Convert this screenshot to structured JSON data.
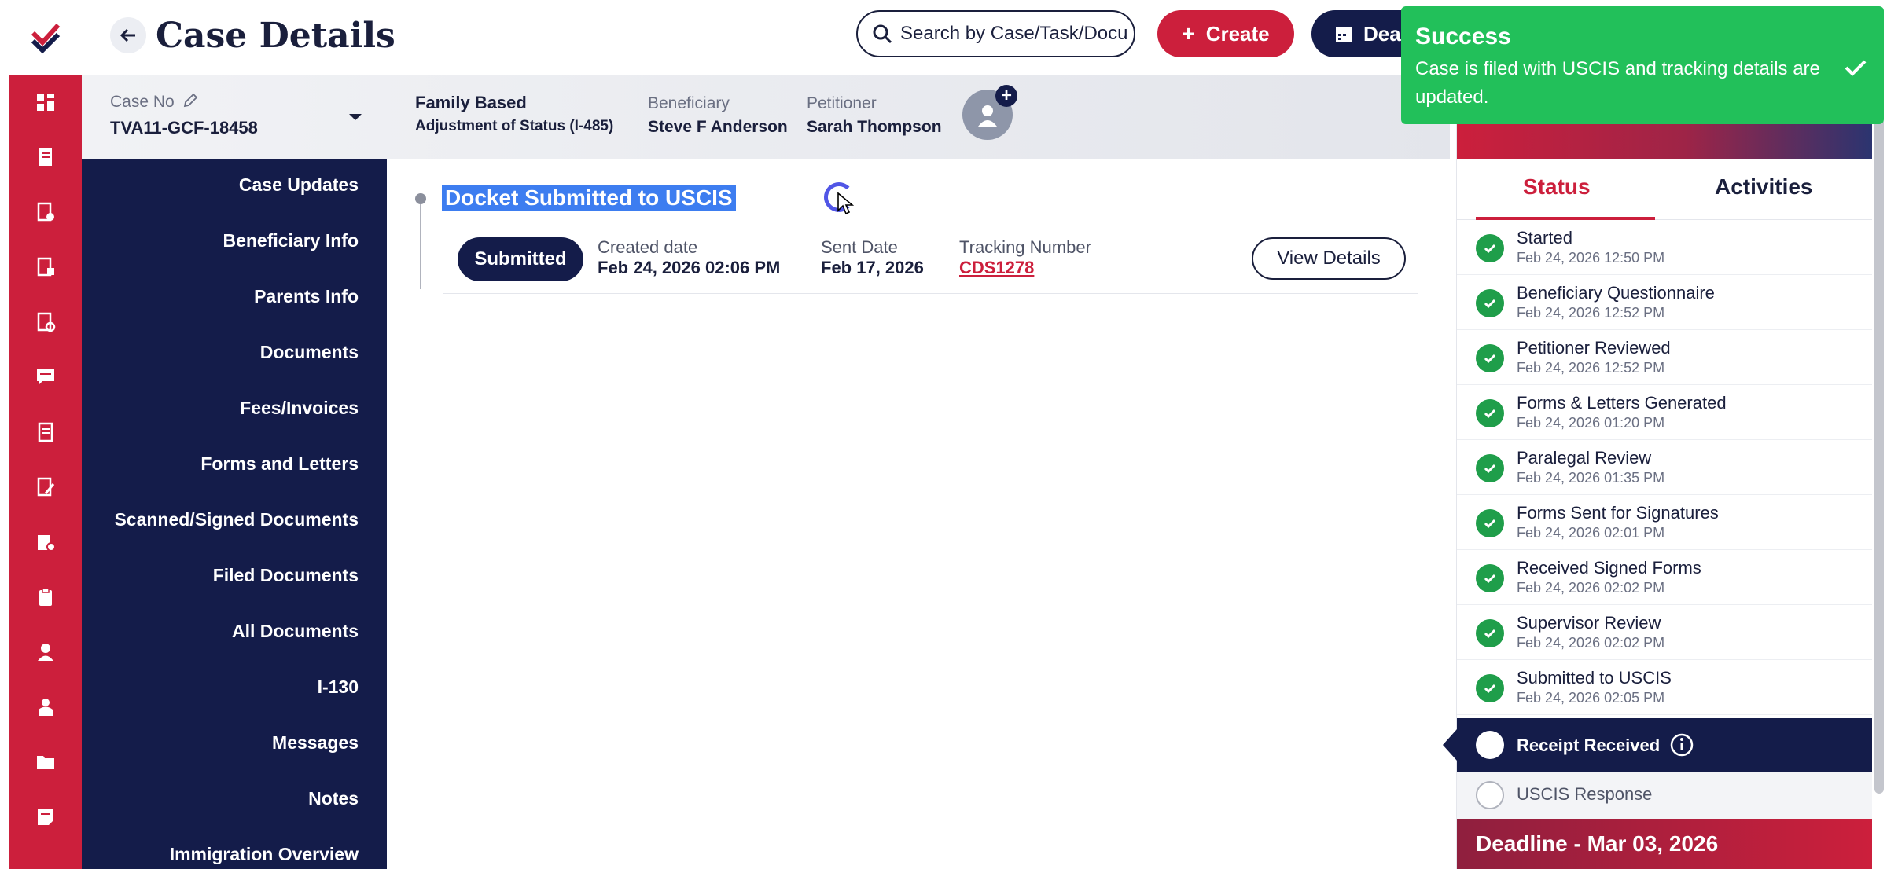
{
  "header": {
    "title": "Case Details",
    "search_placeholder": "Search by Case/Task/Docu",
    "create_label": "Create",
    "deadline_label": "Dea"
  },
  "case": {
    "case_no_label": "Case No",
    "case_no": "TVA11-GCF-18458",
    "category": "Family Based",
    "sub_type": "Adjustment of Status (I-485)",
    "beneficiary_label": "Beneficiary",
    "beneficiary": "Steve F Anderson",
    "petitioner_label": "Petitioner",
    "petitioner": "Sarah Thompson"
  },
  "sidenav": {
    "items": [
      "Case Updates",
      "Beneficiary Info",
      "Parents Info",
      "Documents",
      "Fees/Invoices",
      "Forms and Letters",
      "Scanned/Signed Documents",
      "Filed Documents",
      "All Documents",
      "I-130",
      "Messages",
      "Notes",
      "Immigration Overview"
    ]
  },
  "docket": {
    "title": "Docket Submitted to USCIS",
    "status": "Submitted",
    "created_label": "Created date",
    "created_value": "Feb 24, 2026 02:06 PM",
    "sent_label": "Sent Date",
    "sent_value": "Feb 17, 2026",
    "tracking_label": "Tracking Number",
    "tracking_value": "CDS1278",
    "view_label": "View Details"
  },
  "panel": {
    "tabs": [
      "Status",
      "Activities"
    ],
    "completed": [
      {
        "title": "Started",
        "date": "Feb 24, 2026 12:50 PM"
      },
      {
        "title": "Beneficiary Questionnaire",
        "date": "Feb 24, 2026 12:52 PM"
      },
      {
        "title": "Petitioner Reviewed",
        "date": "Feb 24, 2026 12:52 PM"
      },
      {
        "title": "Forms & Letters Generated",
        "date": "Feb 24, 2026 01:20 PM"
      },
      {
        "title": "Paralegal Review",
        "date": "Feb 24, 2026 01:35 PM"
      },
      {
        "title": "Forms Sent for Signatures",
        "date": "Feb 24, 2026 02:01 PM"
      },
      {
        "title": "Received Signed Forms",
        "date": "Feb 24, 2026 02:02 PM"
      },
      {
        "title": "Supervisor Review",
        "date": "Feb 24, 2026 02:02 PM"
      },
      {
        "title": "Submitted to USCIS",
        "date": "Feb 24, 2026 02:05 PM"
      }
    ],
    "active": "Receipt Received",
    "pending": "USCIS Response",
    "deadline": "Deadline - Mar 03, 2026"
  },
  "toast": {
    "title": "Success",
    "message": "Case is filed with USCIS and tracking details are updated."
  },
  "colors": {
    "brand_red": "#cc1f3c",
    "navy": "#141c4a",
    "success_green": "#22c05a",
    "check_green": "#1f9e4a"
  }
}
